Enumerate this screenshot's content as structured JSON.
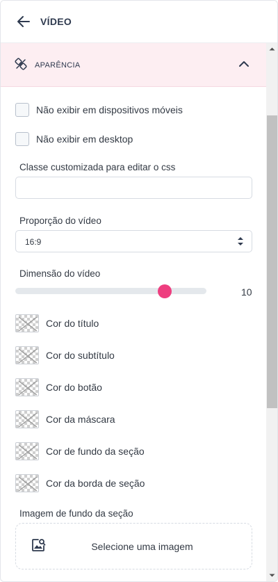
{
  "header": {
    "title": "VÍDEO"
  },
  "section": {
    "title": "APARÊNCIA"
  },
  "checkboxes": [
    {
      "label": "Não exibir em dispositivos móveis",
      "checked": false
    },
    {
      "label": "Não exibir em desktop",
      "checked": false
    }
  ],
  "css_class": {
    "label": "Classe customizada para editar o css",
    "value": ""
  },
  "proportion": {
    "label": "Proporção do vídeo",
    "value": "16:9"
  },
  "dimension": {
    "label": "Dimensão do vídeo",
    "value": "10",
    "fraction": 0.78
  },
  "colors": [
    {
      "label": "Cor do título"
    },
    {
      "label": "Cor do subtítulo"
    },
    {
      "label": "Cor do botão"
    },
    {
      "label": "Cor da máscara"
    },
    {
      "label": "Cor de fundo da seção"
    },
    {
      "label": "Cor da borda de seção"
    }
  ],
  "background_image": {
    "label": "Imagem de fundo da seção",
    "button": "Selecione uma imagem"
  },
  "accent_color": "#ee3e7f"
}
